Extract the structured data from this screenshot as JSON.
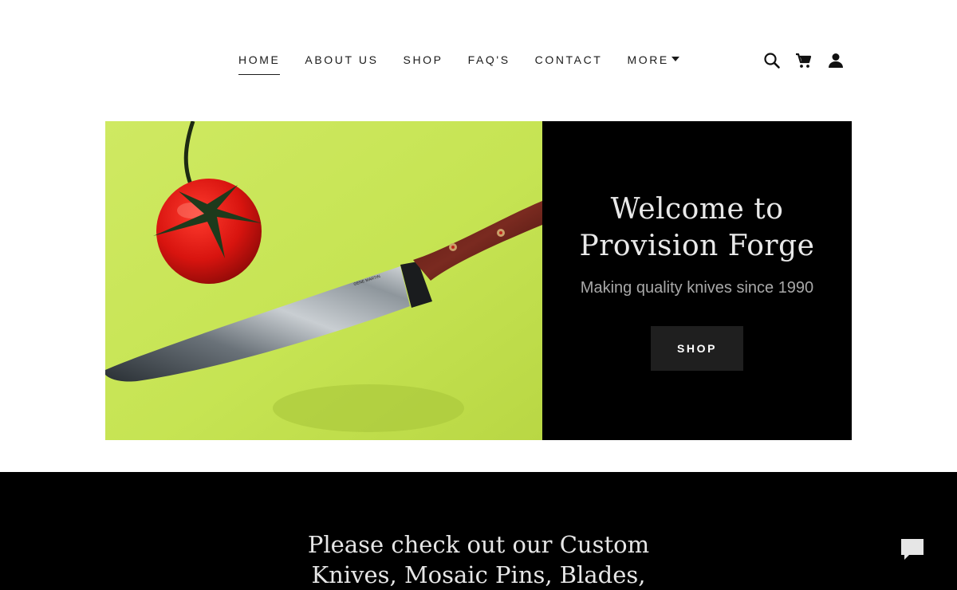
{
  "nav": {
    "links": [
      {
        "label": "HOME",
        "active": true
      },
      {
        "label": "ABOUT US"
      },
      {
        "label": "SHOP"
      },
      {
        "label": "FAQ'S"
      },
      {
        "label": "CONTACT"
      },
      {
        "label": "MORE"
      }
    ],
    "icons": [
      "search-icon",
      "cart-icon",
      "account-icon"
    ]
  },
  "hero": {
    "title_line1": "Welcome to",
    "title_line2": "Provision Forge",
    "subtitle": "Making quality knives since 1990",
    "button_label": "SHOP"
  },
  "section": {
    "text_line1": "Please check out our Custom",
    "text_line2": "Knives, Mosaic Pins, Blades,"
  },
  "colors": {
    "background": "#ffffff",
    "dark": "#000000",
    "button": "#1f1f1f",
    "image_backdrop": "#c9e556"
  }
}
